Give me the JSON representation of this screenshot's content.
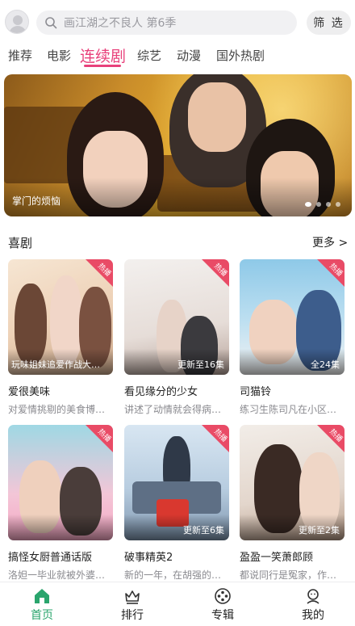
{
  "search": {
    "placeholder": "画江湖之不良人 第6季",
    "filter_label": "筛 选"
  },
  "tabs": [
    {
      "label": "推荐"
    },
    {
      "label": "电影"
    },
    {
      "label": "连续剧"
    },
    {
      "label": "综艺"
    },
    {
      "label": "动漫"
    },
    {
      "label": "国外热剧"
    }
  ],
  "active_tab": "连续剧",
  "banner": {
    "caption": "掌门的烦恼",
    "slide_count": 4,
    "active_slide": 0
  },
  "section": {
    "title": "喜剧",
    "more_label": "更多 >"
  },
  "hot_badge": "热播",
  "cards": [
    {
      "title": "爱很美味",
      "desc": "对爱情挑剔的美食博…",
      "note": "玩味姐妹追爱作战大…",
      "hot": true
    },
    {
      "title": "看见缘分的少女",
      "desc": "讲述了动情就会得病…",
      "note": "更新至16集",
      "hot": true
    },
    {
      "title": "司猫铃",
      "desc": "练习生陈司凡在小区…",
      "note": "全24集",
      "hot": true
    },
    {
      "title": "搞怪女厨普通话版",
      "desc": "洛妲一毕业就被外婆…",
      "note": "",
      "hot": true
    },
    {
      "title": "破事精英2",
      "desc": "新的一年，在胡强的…",
      "note": "更新至6集",
      "hot": true
    },
    {
      "title": "盈盈一笑萧郎顾",
      "desc": "都说同行是冤家，作…",
      "note": "更新至2集",
      "hot": true
    }
  ],
  "bottom_nav": [
    {
      "label": "首页",
      "icon": "home-icon",
      "active": true
    },
    {
      "label": "排行",
      "icon": "ranking-icon",
      "active": false
    },
    {
      "label": "专辑",
      "icon": "album-icon",
      "active": false
    },
    {
      "label": "我的",
      "icon": "profile-icon",
      "active": false
    }
  ],
  "colors": {
    "accent": "#e8417b",
    "nav_active": "#2aa56d",
    "hot_badge": "#e94b66"
  }
}
